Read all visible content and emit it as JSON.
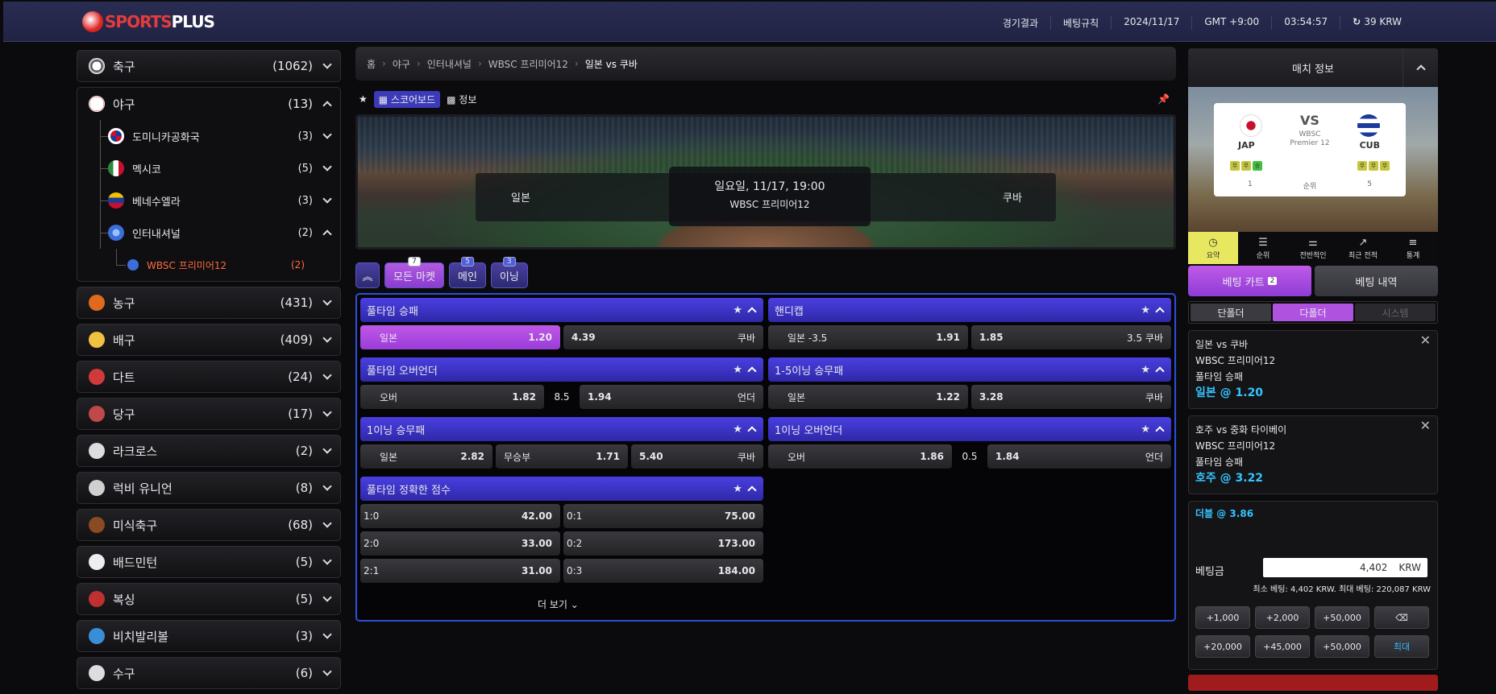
{
  "brand": {
    "p1": "SPORTS",
    "p2": " PLUS"
  },
  "topnav": {
    "results": "경기결과",
    "rules": "베팅규칙",
    "date": "2024/11/17",
    "tz": "GMT +9:00",
    "time": "03:54:57",
    "balance": "39 KRW"
  },
  "sidebar": {
    "sports_top": [
      {
        "name": "축구",
        "count": "(1062)",
        "color": "#ffffff"
      }
    ],
    "baseball": {
      "name": "야구",
      "count": "(13)",
      "countries": [
        {
          "name": "도미니카공화국",
          "count": "(3)",
          "color": "#c8102e"
        },
        {
          "name": "멕시코",
          "count": "(5)",
          "color": "#2e8b3d"
        },
        {
          "name": "베네수엘라",
          "count": "(3)",
          "color": "#f2c200"
        },
        {
          "name": "인터내셔널",
          "count": "(2)",
          "color": "#3b6ed8"
        }
      ],
      "league": {
        "name": "WBSC 프리미어12",
        "count": "(2)"
      }
    },
    "sports": [
      {
        "name": "농구",
        "count": "(431)",
        "color": "#e06a1c"
      },
      {
        "name": "배구",
        "count": "(409)",
        "color": "#f0c040"
      },
      {
        "name": "다트",
        "count": "(24)",
        "color": "#d03a3a"
      },
      {
        "name": "당구",
        "count": "(17)",
        "color": "#c04848"
      },
      {
        "name": "라크로스",
        "count": "(2)",
        "color": "#dddddd"
      },
      {
        "name": "럭비 유니언",
        "count": "(8)",
        "color": "#d0d0d0"
      },
      {
        "name": "미식축구",
        "count": "(68)",
        "color": "#8a4a22"
      },
      {
        "name": "배드민턴",
        "count": "(5)",
        "color": "#eeeeee"
      },
      {
        "name": "복싱",
        "count": "(5)",
        "color": "#c03030"
      },
      {
        "name": "비치발리볼",
        "count": "(3)",
        "color": "#3a8ed8"
      },
      {
        "name": "수구",
        "count": "(6)",
        "color": "#dddddd"
      }
    ]
  },
  "breadcrumb": [
    "홈",
    "야구",
    "인터내셔널",
    "WBSC 프리미어12",
    "일본 vs 쿠바"
  ],
  "tools": {
    "scoreboard": "스코어보드",
    "info": "정보"
  },
  "match": {
    "home": "일본",
    "away": "쿠바",
    "datetime": "일요일, 11/17, 19:00",
    "league": "WBSC 프리미어12"
  },
  "tabs": [
    {
      "label": "모든 마켓",
      "badge": "7"
    },
    {
      "label": "메인",
      "badge": "5"
    },
    {
      "label": "이닝",
      "badge": "3"
    }
  ],
  "markets": {
    "m1": {
      "title": "풀타임 승패",
      "a_label": "일본",
      "a_odds": "1.20",
      "b_odds": "4.39",
      "b_label": "쿠바"
    },
    "m2": {
      "title": "핸디캡",
      "a_label": "일본 -3.5",
      "a_odds": "1.91",
      "b_odds": "1.85",
      "b_label": "3.5 쿠바"
    },
    "m3": {
      "title": "풀타임 오버언더",
      "a_label": "오버",
      "a_odds": "1.82",
      "line": "8.5",
      "b_odds": "1.94",
      "b_label": "언더"
    },
    "m4": {
      "title": "1-5이닝 승무패",
      "a_label": "일본",
      "a_odds": "1.22",
      "b_odds": "3.28",
      "b_label": "쿠바"
    },
    "m5": {
      "title": "1이닝 승무패",
      "a_label": "일본",
      "a_odds": "2.82",
      "d_label": "무승부",
      "d_odds": "1.71",
      "b_odds": "5.40",
      "b_label": "쿠바"
    },
    "m6": {
      "title": "1이닝 오버언더",
      "a_label": "오버",
      "a_odds": "1.86",
      "line": "0.5",
      "b_odds": "1.84",
      "b_label": "언더"
    },
    "m7": {
      "title": "풀타임 정확한 점수",
      "rows": [
        {
          "s1": "1:0",
          "o1": "42.00",
          "s2": "0:1",
          "o2": "75.00"
        },
        {
          "s1": "2:0",
          "o1": "33.00",
          "s2": "0:2",
          "o2": "173.00"
        },
        {
          "s1": "2:1",
          "o1": "31.00",
          "s2": "0:3",
          "o2": "184.00"
        }
      ],
      "more": "더 보기 ⌄"
    }
  },
  "right": {
    "title": "매치 정보",
    "card": {
      "vs": "VS",
      "sub1": "WBSC",
      "sub2": "Premier 12",
      "home": "JAP",
      "away": "CUB",
      "home_rank": "1",
      "rank_label": "순위",
      "away_rank": "5",
      "home_form": [
        "무",
        "무",
        "승"
      ],
      "away_form": [
        "무",
        "무",
        "무"
      ]
    },
    "stat_tabs": [
      {
        "label": "요약",
        "glyph": "◷"
      },
      {
        "label": "순위",
        "glyph": "☰"
      },
      {
        "label": "전반적인",
        "glyph": "⚌"
      },
      {
        "label": "최근 전적",
        "glyph": "↗"
      },
      {
        "label": "통계",
        "glyph": "≡"
      }
    ],
    "cart": {
      "label": "베팅 카트",
      "count": "2",
      "history": "베팅 내역"
    },
    "types": [
      "단폴더",
      "다폴더",
      "시스템"
    ],
    "slips": [
      {
        "match": "일본 vs 쿠바",
        "league": "WBSC 프리미어12",
        "market": "풀타임 승패",
        "pick": "일본 @ 1.20"
      },
      {
        "match": "호주 vs 중화 타이베이",
        "league": "WBSC 프리미어12",
        "market": "풀타임 승패",
        "pick": "호주 @ 3.22"
      }
    ],
    "total": {
      "double": "더블 @ 3.86",
      "amount_label": "베팅금",
      "amount": "4,402",
      "currency": "KRW",
      "limits": "최소 베팅: 4,402 KRW. 최대 베팅: 220,087 KRW"
    },
    "keys": [
      "+1,000",
      "+2,000",
      "+50,000",
      "⌫",
      "+20,000",
      "+45,000",
      "+50,000",
      "최대"
    ]
  }
}
